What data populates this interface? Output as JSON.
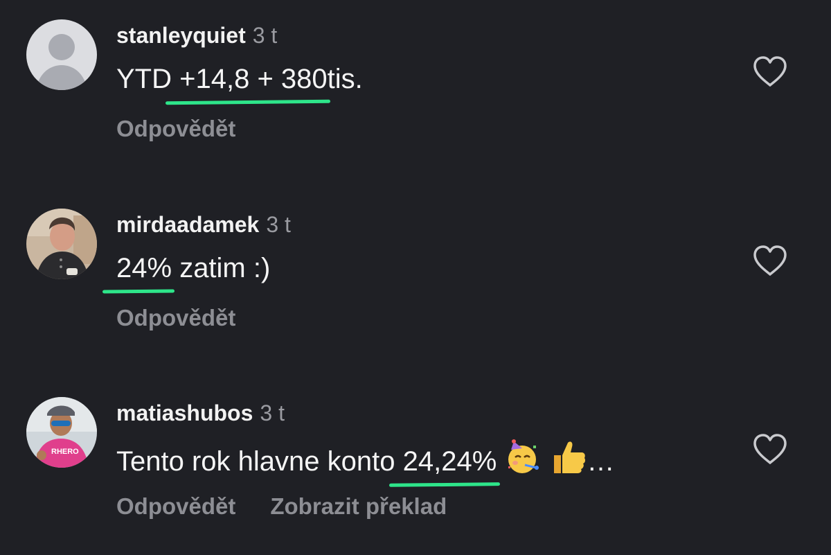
{
  "comments": [
    {
      "username": "stanleyquiet",
      "time": "3 t",
      "text_before": "YTD",
      "text_highlight": "+14,8 + 380",
      "text_after": "tis.",
      "reply_label": "Odpovědět",
      "avatar_icon": "default-user-avatar",
      "like_icon": "heart-outline-icon"
    },
    {
      "username": "mirdaadamek",
      "time": "3 t",
      "text_before": "",
      "text_highlight": "24%",
      "text_after": "zatim :)",
      "reply_label": "Odpovědět",
      "avatar_icon": "user-photo-avatar",
      "like_icon": "heart-outline-icon"
    },
    {
      "username": "matiashubos",
      "time": "3 t",
      "text_before": "Tento rok hlavne konto",
      "text_highlight": "24,24%",
      "text_after": "…",
      "reply_label": "Odpovědět",
      "translate_label": "Zobrazit překlad",
      "avatar_icon": "user-photo-avatar",
      "like_icon": "heart-outline-icon",
      "emojis": [
        "partying-face-icon",
        "thumbs-up-icon"
      ]
    }
  ],
  "colors": {
    "background": "#1f2025",
    "highlight_underline": "#2ee58a",
    "secondary_text": "#8d8e94"
  }
}
